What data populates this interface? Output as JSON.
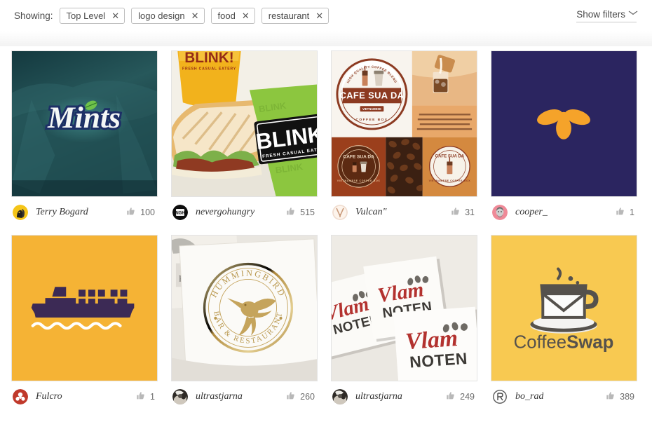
{
  "filter_bar": {
    "showing_label": "Showing:",
    "chips": [
      {
        "label": "Top Level",
        "remove": "✕"
      },
      {
        "label": "logo design",
        "remove": "✕"
      },
      {
        "label": "food",
        "remove": "✕"
      },
      {
        "label": "restaurant",
        "remove": "✕"
      }
    ],
    "show_filters_label": "Show filters",
    "show_filters_caret": "⌄"
  },
  "grid": {
    "cards": [
      {
        "id": "mints",
        "design_title": "Mints",
        "username": "Terry Bogard",
        "likes": "100",
        "avatar_bg": "#f5c518",
        "thumb_bg": "#1d4f52"
      },
      {
        "id": "blink-bakery",
        "design_title": "BLINK! Fresh Casual Eatery",
        "username": "nevergohungry",
        "likes": "515",
        "avatar_bg": "#111111",
        "thumb_bg": "#e7c96a"
      },
      {
        "id": "cafe-sua-da",
        "design_title": "Cafe Sua Da",
        "username": "Vulcan\"",
        "likes": "31",
        "avatar_bg": "#e8d3c4",
        "thumb_bg": "#f6f1ea"
      },
      {
        "id": "bee-mark",
        "design_title": "Bee mark",
        "username": "cooper_",
        "likes": "1",
        "avatar_bg": "#f08a96",
        "thumb_bg": "#2b2560"
      },
      {
        "id": "cargo-ship",
        "design_title": "Cargo ship",
        "username": "Fulcro",
        "likes": "1",
        "avatar_bg": "#c8372d",
        "thumb_bg": "#f5b335"
      },
      {
        "id": "hummingbird",
        "design_title": "Hummingbird Bar & Restaurant",
        "username": "ultrastjarna",
        "likes": "260",
        "avatar_bg": "#3b3630",
        "thumb_bg": "#ece9e4"
      },
      {
        "id": "vlam-noten",
        "design_title": "Vlam Noten",
        "username": "ultrastjarna",
        "likes": "249",
        "avatar_bg": "#3b3630",
        "thumb_bg": "#eceae5"
      },
      {
        "id": "coffeeswap",
        "design_title": "CoffeeSwap",
        "username": "bo_rad",
        "likes": "389",
        "avatar_bg": "#ffffff",
        "thumb_bg": "#f7c850"
      }
    ]
  },
  "thumb_text": {
    "blink_title": "BLINK!",
    "blink_sub": "FRESH CASUAL EATERY",
    "cafe_title": "CAFE SUA DA",
    "cafe_sub": "VIETNAMESE",
    "cafe_ring_top": "HIGH QUALITY COFFEE BLEND",
    "cafe_ring_bottom": "COFFEE BOX",
    "hummingbird_top": "HUMMINGBIRD",
    "hummingbird_bottom": "BAR & RESTAURANT",
    "vlam_script": "Vlam",
    "vlam_bold": "NOTEN",
    "coffeeswap_light": "Coffee",
    "coffeeswap_bold": "Swap",
    "mints_word": "Mints"
  },
  "icons": {
    "like": "thumbs-up-icon",
    "chip_close": "close-icon",
    "chevron": "chevron-down-icon"
  },
  "colors": {
    "text": "#4a4a4a",
    "chip_border": "#bfbfbf",
    "username": "#333333",
    "like_gray": "#b8b8b8"
  }
}
